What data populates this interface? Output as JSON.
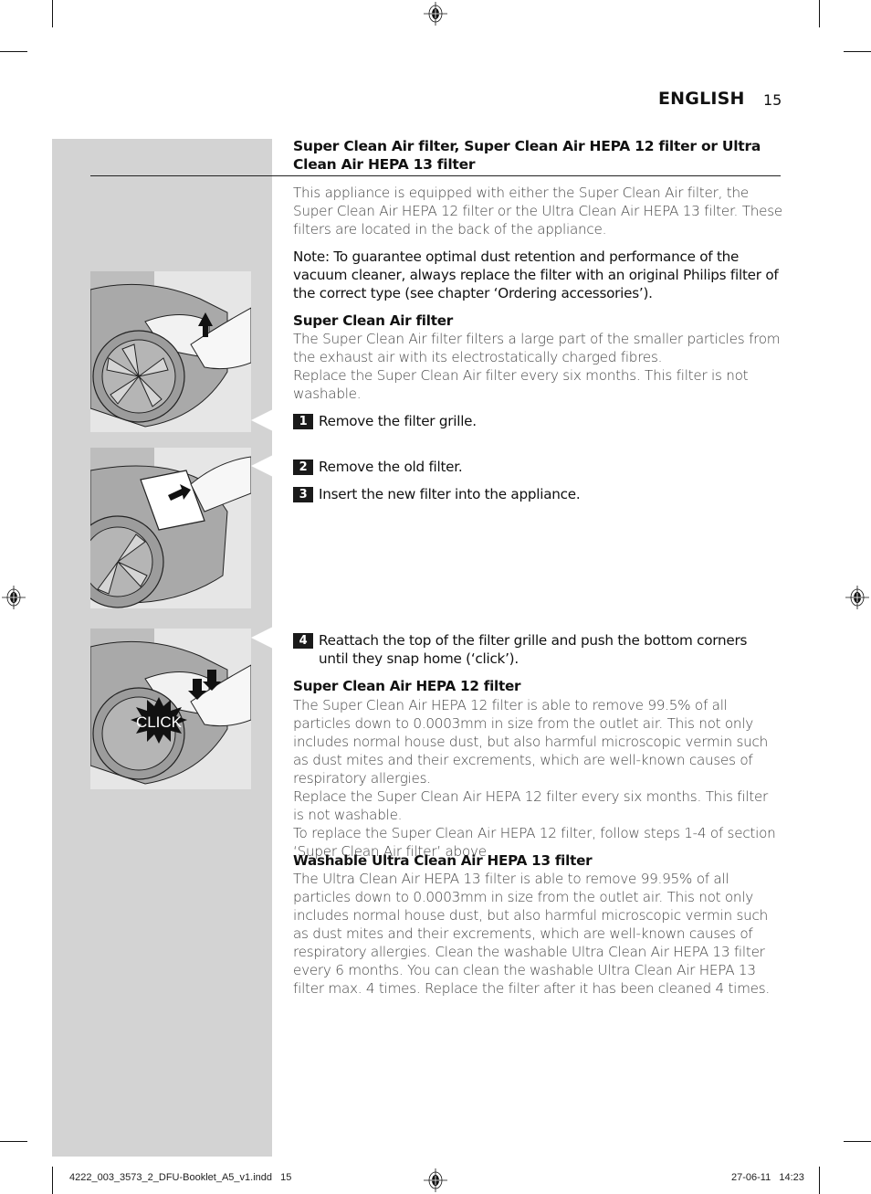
{
  "header": {
    "language": "ENGLISH",
    "page_number": "15"
  },
  "section": {
    "title": "Super Clean Air filter, Super Clean Air HEPA 12 filter or Ultra Clean Air HEPA 13 filter",
    "intro": "This appliance is equipped with either the Super Clean Air filter, the Super Clean Air HEPA 12 filter or the Ultra Clean Air HEPA 13 filter. These filters are located in the back of the appliance.",
    "note": "Note: To guarantee optimal dust retention and performance of the vacuum cleaner, always replace the filter with an original Philips filter of the correct type (see chapter ‘Ordering accessories’)."
  },
  "super_clean": {
    "heading": "Super Clean Air filter",
    "body1": "The Super Clean Air filter filters a large part of the smaller particles from the exhaust air with its electrostatically charged fibres.",
    "body2": "Replace the Super Clean Air filter every six months. This filter is not washable."
  },
  "steps": [
    {
      "num": "1",
      "text": "Remove the filter grille."
    },
    {
      "num": "2",
      "text": "Remove the old filter."
    },
    {
      "num": "3",
      "text": "Insert the new filter into the appliance."
    },
    {
      "num": "4",
      "text": "Reattach the top of the filter grille and push the bottom corners until they snap home (‘click’)."
    }
  ],
  "hepa12": {
    "heading": "Super Clean Air HEPA 12 filter",
    "body1": "The Super Clean Air HEPA 12 filter is able to remove 99.5% of all particles down to 0.0003mm in size from the outlet air. This not only includes normal house dust, but also harmful microscopic vermin such as dust mites and their excrements, which are well-known causes of respiratory allergies.",
    "body2": "Replace the Super Clean Air HEPA 12 filter every six months. This filter is not washable.",
    "body3": "To replace the Super Clean Air HEPA 12 filter, follow steps 1-4 of section ‘Super Clean Air filter’ above."
  },
  "hepa13": {
    "heading": "Washable Ultra Clean Air HEPA 13 filter",
    "body": "The Ultra Clean Air HEPA 13 filter is able to remove 99.95% of all particles down to 0.0003mm in size from the outlet air. This not only includes normal house dust, but also harmful microscopic vermin such as dust mites and their excrements, which are well-known causes of respiratory allergies. Clean the washable Ultra Clean Air HEPA 13 filter every 6 months. You can clean the washable Ultra Clean Air HEPA 13 filter max. 4 times. Replace the filter after it has been cleaned 4 times."
  },
  "illustrations": [
    {
      "name": "remove-filter-grille",
      "arrow": "up"
    },
    {
      "name": "insert-new-filter",
      "arrow": "right"
    },
    {
      "name": "reattach-grille-click",
      "arrow": "down",
      "label": "CLICK"
    }
  ],
  "footer": {
    "file": "4222_003_3573_2_DFU-Booklet_A5_v1.indd   15",
    "datetime": "27-06-11   14:23"
  },
  "colors": {
    "sidebar_grey": "#d3d3d3",
    "image_bg": "#e6e6e6",
    "text_dark": "#111111",
    "text_body": "#444444"
  }
}
